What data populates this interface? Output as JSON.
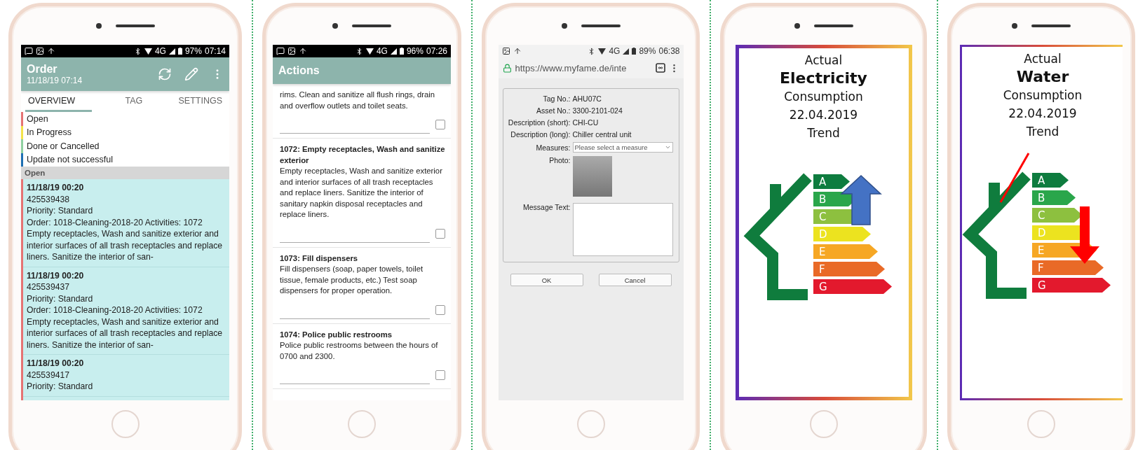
{
  "phones": [
    {
      "kind": "orders",
      "status_bar": {
        "kind": "dark",
        "notifications": [
          {
            "kind": "message"
          },
          {
            "kind": "image"
          },
          {
            "kind": "upload"
          }
        ],
        "network": "4G",
        "battery": "97%",
        "time": "07:14"
      },
      "app_bar": {
        "title": "Order",
        "subtitle": "11/18/19 07:14"
      },
      "tabs": [
        {
          "label": "OVERVIEW",
          "selected": true
        },
        {
          "label": "TAG",
          "selected": false
        },
        {
          "label": "SETTINGS",
          "selected": false
        }
      ],
      "legend": [
        {
          "label": "Open",
          "color": "#e57373"
        },
        {
          "label": "In Progress",
          "color": "#f3e34a"
        },
        {
          "label": "Done or Cancelled",
          "color": "#8fd0a0"
        },
        {
          "label": "Update not successful",
          "color": "#1e6fb3"
        }
      ],
      "section": "Open",
      "orders": [
        {
          "date": "11/18/19 00:20",
          "number": "425539438",
          "priority": "Priority: Standard",
          "text": "Order: 1018-Cleaning-2018-20 Activities: 1072 Empty receptacles, Wash and sanitize exterior and interior surfaces of all trash receptacles and replace liners. Sanitize the interior of san-"
        },
        {
          "date": "11/18/19 00:20",
          "number": "425539437",
          "priority": "Priority: Standard",
          "text": "Order: 1018-Cleaning-2018-20 Activities: 1072 Empty receptacles, Wash and sanitize exterior and interior surfaces of all trash receptacles and replace liners. Sanitize the interior of san-"
        },
        {
          "date": "11/18/19 00:20",
          "number": "425539417",
          "priority": "Priority: Standard"
        }
      ]
    },
    {
      "kind": "actions",
      "status_bar": {
        "kind": "dark",
        "notifications": [
          {
            "kind": "message"
          },
          {
            "kind": "image"
          },
          {
            "kind": "upload"
          }
        ],
        "network": "4G",
        "battery": "96%",
        "time": "07:26"
      },
      "app_bar": {
        "title": "Actions"
      },
      "actions": [
        {
          "text": "rims. Clean and sanitize all flush rings, drain and overflow outlets and toilet seats.",
          "checked": false
        },
        {
          "title": "1072: Empty receptacles, Wash and sanitize exterior",
          "text": "Empty receptacles, Wash and sanitize exterior and interior surfaces of all trash receptacles and replace liners. Sanitize the interior of sanitary napkin disposal receptacles and replace liners.",
          "checked": false
        },
        {
          "title": "1073: Fill dispensers",
          "text": "Fill dispensers (soap, paper towels, toilet tissue, female products, etc.) Test soap dispensers for proper operation.",
          "checked": false
        },
        {
          "title": "1074: Police public restrooms",
          "text": "Police public restrooms between the hours of 0700 and 2300.",
          "checked": false
        }
      ]
    },
    {
      "kind": "form",
      "status_bar": {
        "kind": "light",
        "notifications": [
          {
            "kind": "image"
          },
          {
            "kind": "upload"
          }
        ],
        "network": "4G",
        "battery": "89%",
        "time": "06:38"
      },
      "url": "https://www.myfame.de/inte",
      "fields": [
        {
          "label": "Tag No.:",
          "value": "AHU07C"
        },
        {
          "label": "Asset No.:",
          "value": "3300-2101-024"
        },
        {
          "label": "Description (short):",
          "value": "CHI-CU"
        },
        {
          "label": "Description (long):",
          "value": "Chiller central unit"
        }
      ],
      "measures": {
        "label": "Measures:",
        "placeholder": "Please select a measure"
      },
      "photo_label": "Photo:",
      "message_label": "Message Text:",
      "buttons": [
        "OK",
        "Cancel"
      ]
    },
    {
      "kind": "energy",
      "heading": [
        {
          "text": "Actual",
          "kind": "line"
        },
        {
          "text": "Electricity",
          "kind": "title"
        },
        {
          "text": "Consumption",
          "kind": "line"
        },
        {
          "text": "22.04.2019",
          "kind": "line"
        },
        {
          "text": "Trend",
          "kind": "line"
        }
      ],
      "improving": true,
      "classes": [
        {
          "letter": "A",
          "color": "#0e7c3f"
        },
        {
          "letter": "B",
          "color": "#2aa64b"
        },
        {
          "letter": "C",
          "color": "#8dc03f"
        },
        {
          "letter": "D",
          "color": "#ece31f"
        },
        {
          "letter": "E",
          "color": "#f6a724"
        },
        {
          "letter": "F",
          "color": "#e96a27"
        },
        {
          "letter": "G",
          "color": "#e3192d"
        }
      ]
    },
    {
      "kind": "energy",
      "heading": [
        {
          "text": "Actual",
          "kind": "line"
        },
        {
          "text": "Water",
          "kind": "title"
        },
        {
          "text": "Consumption",
          "kind": "line"
        },
        {
          "text": "22.04.2019",
          "kind": "line"
        },
        {
          "text": "Trend",
          "kind": "line"
        }
      ],
      "improving": false,
      "slash": true,
      "classes": [
        {
          "letter": "A",
          "color": "#0e7c3f"
        },
        {
          "letter": "B",
          "color": "#2aa64b"
        },
        {
          "letter": "C",
          "color": "#8dc03f"
        },
        {
          "letter": "D",
          "color": "#ece31f"
        },
        {
          "letter": "E",
          "color": "#f6a724"
        },
        {
          "letter": "F",
          "color": "#e96a27"
        },
        {
          "letter": "G",
          "color": "#e3192d"
        }
      ]
    }
  ]
}
